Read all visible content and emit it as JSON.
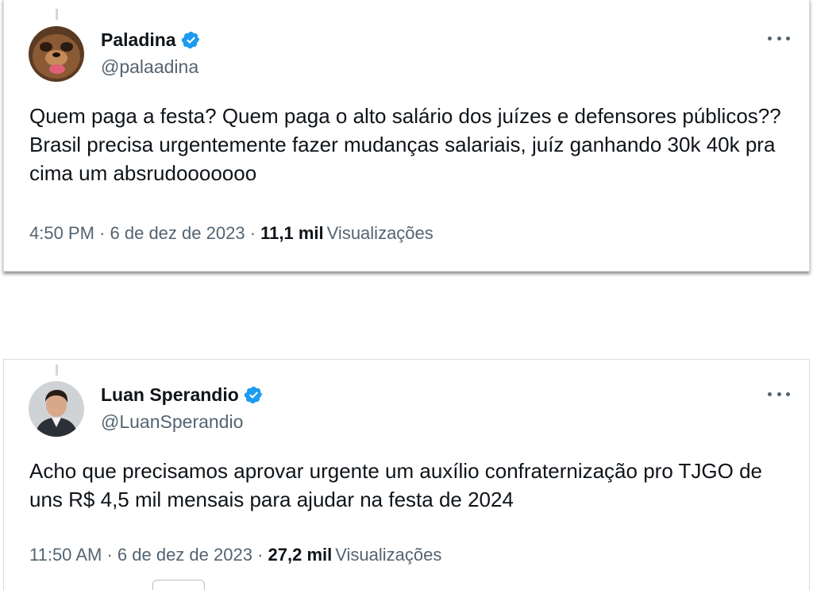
{
  "tweets": [
    {
      "author": {
        "display_name": "Paladina",
        "handle": "@palaadina",
        "verified": true,
        "avatar_icon": "user-avatar-icon"
      },
      "text": "Quem paga a festa? Quem paga o alto salário dos juízes e defensores públicos?? Brasil precisa urgentemente fazer mudanças salariais, juíz ganhando 30k 40k pra cima um absrudooooooo",
      "time": "4:50 PM",
      "date": "6 de dez de 2023",
      "views_count": "11,1 mil",
      "views_label": "Visualizações",
      "separator": "·"
    },
    {
      "author": {
        "display_name": "Luan Sperandio",
        "handle": "@LuanSperandio",
        "verified": true,
        "avatar_icon": "user-avatar-icon"
      },
      "text": "Acho que precisamos aprovar urgente um auxílio confraternização pro TJGO de uns R$ 4,5 mil mensais para ajudar na festa de 2024",
      "time": "11:50 AM",
      "date": "6 de dez de 2023",
      "views_count": "27,2 mil",
      "views_label": "Visualizações",
      "separator": "·"
    }
  ],
  "colors": {
    "verified_blue": "#1d9bf0",
    "secondary_text": "#536471",
    "primary_text": "#0f1419"
  }
}
